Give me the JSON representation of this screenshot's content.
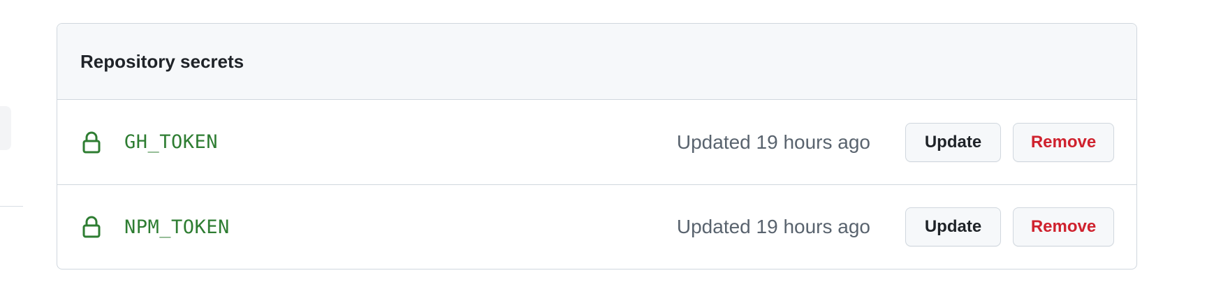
{
  "secrets_box": {
    "title": "Repository secrets",
    "rows": [
      {
        "name": "GH_TOKEN",
        "updated": "Updated 19 hours ago",
        "update_label": "Update",
        "remove_label": "Remove",
        "icon": "lock-icon"
      },
      {
        "name": "NPM_TOKEN",
        "updated": "Updated 19 hours ago",
        "update_label": "Update",
        "remove_label": "Remove",
        "icon": "lock-icon"
      }
    ]
  },
  "colors": {
    "secret_name": "#2e7d32",
    "remove_text": "#cf222e",
    "header_bg": "#f6f8fa",
    "border": "#d0d7de"
  }
}
